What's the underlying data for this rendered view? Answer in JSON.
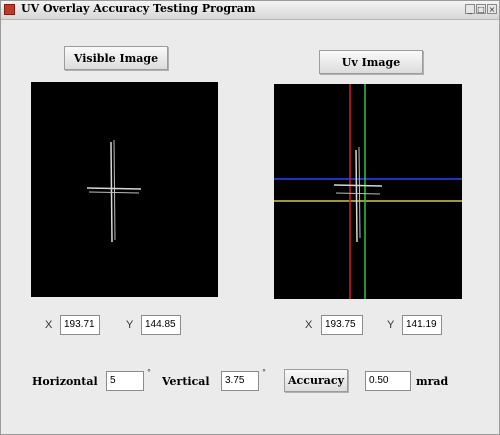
{
  "window": {
    "title": "UV Overlay Accuracy Testing Program"
  },
  "visible": {
    "button_label": "Visible Image",
    "x_label": "X",
    "x_value": "193.71",
    "y_label": "Y",
    "y_value": "144.85"
  },
  "uv": {
    "button_label": "Uv Image",
    "x_label": "X",
    "x_value": "193.75",
    "y_label": "Y",
    "y_value": "141.19"
  },
  "controls": {
    "horizontal_label": "Horizontal",
    "horizontal_value": "5",
    "vertical_label": "Vertical",
    "vertical_value": "3.75",
    "degree_symbol": "°",
    "accuracy_button": "Accuracy",
    "accuracy_value": "0.50",
    "unit": "mrad"
  },
  "colors": {
    "crosshair_red": "#d22020",
    "crosshair_green": "#2ec24a",
    "crosshair_blue": "#1f33c8",
    "crosshair_yellow": "#d6c84a",
    "target": "#d8d8d8"
  }
}
